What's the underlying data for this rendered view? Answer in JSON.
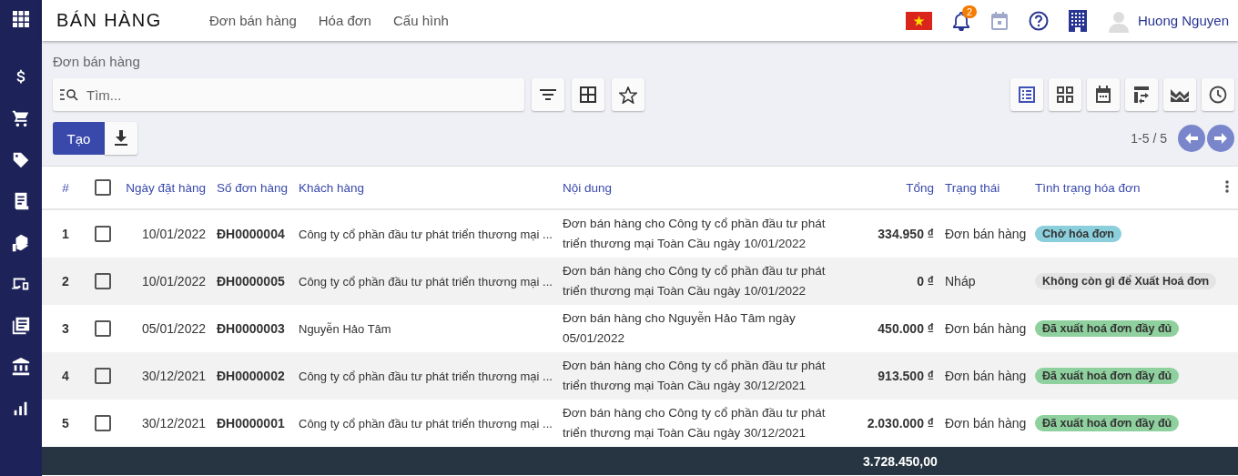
{
  "app": {
    "title": "BÁN HÀNG",
    "menu": [
      "Đơn bán hàng",
      "Hóa đơn",
      "Cấu hình"
    ],
    "notifications": "2",
    "user": "Huong Nguyen"
  },
  "breadcrumb": "Đơn bán hàng",
  "search": {
    "placeholder": "Tìm..."
  },
  "create_button": "Tạo",
  "views": [
    {
      "kind": "list",
      "selected": true
    },
    {
      "kind": "kanban",
      "selected": false
    },
    {
      "kind": "calendar",
      "selected": false
    },
    {
      "kind": "pivot",
      "selected": false
    },
    {
      "kind": "graph",
      "selected": false
    },
    {
      "kind": "activity",
      "selected": false
    }
  ],
  "pager": "1-5 / 5",
  "table": {
    "select_all_checked": false,
    "columns": [
      "#",
      "Ngày đặt hàng",
      "Số đơn hàng",
      "Khách hàng",
      "Nội dung",
      "Tổng",
      "Trạng thái",
      "Tình trạng hóa đơn"
    ],
    "rows": [
      {
        "index": "1",
        "checked": false,
        "date": "10/01/2022",
        "number": "ĐH0000004",
        "customer": "Công ty cổ phần đầu tư phát triển thương mại ...",
        "content": "Đơn bán hàng cho Công ty cổ phần đầu tư phát triển thương mại Toàn Cầu ngày 10/01/2022",
        "total": "334.950 ₫",
        "status": "Đơn bán hàng",
        "invoice_status": "Chờ hóa đơn",
        "color": "#8ccfdc"
      },
      {
        "index": "2",
        "checked": false,
        "date": "10/01/2022",
        "number": "ĐH0000005",
        "customer": "Công ty cổ phần đầu tư phát triển thương mại ...",
        "content": "Đơn bán hàng cho Công ty cổ phần đầu tư phát triển thương mại Toàn Cầu ngày 10/01/2022",
        "total": "0 ₫",
        "status": "Nháp",
        "invoice_status": "Không còn gì để Xuất Hoá đơn",
        "color": "#e4e4e4"
      },
      {
        "index": "3",
        "checked": false,
        "date": "05/01/2022",
        "number": "ĐH0000003",
        "customer": "Nguyễn Hảo Tâm",
        "content": "Đơn bán hàng cho Nguyễn Hảo Tâm ngày 05/01/2022",
        "total": "450.000 ₫",
        "status": "Đơn bán hàng",
        "invoice_status": "Đã xuất hoá đơn đầy đủ",
        "color": "#8fd19e"
      },
      {
        "index": "4",
        "checked": false,
        "date": "30/12/2021",
        "number": "ĐH0000002",
        "customer": "Công ty cổ phần đầu tư phát triển thương mại ...",
        "content": "Đơn bán hàng cho Công ty cổ phần đầu tư phát triển thương mại Toàn Cầu ngày 30/12/2021",
        "total": "913.500 ₫",
        "status": "Đơn bán hàng",
        "invoice_status": "Đã xuất hoá đơn đầy đủ",
        "color": "#8fd19e"
      },
      {
        "index": "5",
        "checked": false,
        "date": "30/12/2021",
        "number": "ĐH0000001",
        "customer": "Công ty cổ phần đầu tư phát triển thương mại ...",
        "content": "Đơn bán hàng cho Công ty cổ phần đầu tư phát triển thương mại Toàn Cầu ngày 30/12/2021",
        "total": "2.030.000 ₫",
        "status": "Đơn bán hàng",
        "invoice_status": "Đã xuất hoá đơn đầy đủ",
        "color": "#8fd19e"
      }
    ],
    "sum_total": "3.728.450,00"
  }
}
